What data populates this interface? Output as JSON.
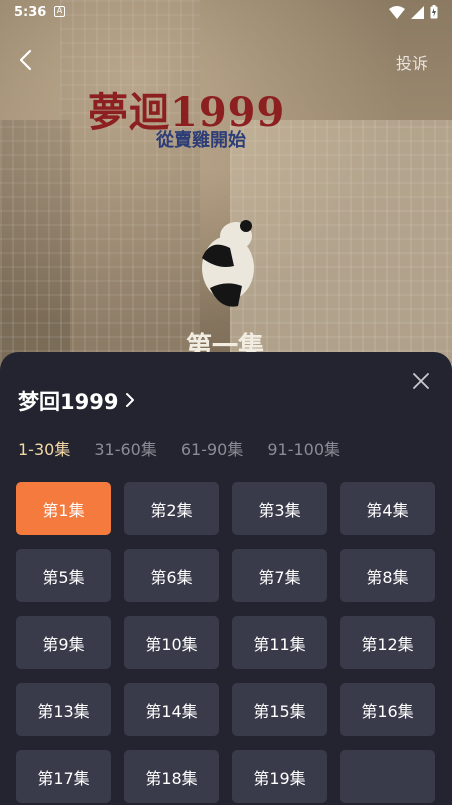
{
  "status_bar": {
    "time": "5:36"
  },
  "header": {
    "report_label": "投诉"
  },
  "poster": {
    "title": "夢迴1999",
    "subtitle": "從賣雞開始",
    "episode_caption": "第一集"
  },
  "sheet": {
    "show_title": "梦回1999",
    "tabs": [
      {
        "label": "1-30集",
        "active": true
      },
      {
        "label": "31-60集",
        "active": false
      },
      {
        "label": "61-90集",
        "active": false
      },
      {
        "label": "91-100集",
        "active": false
      }
    ],
    "episodes": [
      "第1集",
      "第2集",
      "第3集",
      "第4集",
      "第5集",
      "第6集",
      "第7集",
      "第8集",
      "第9集",
      "第10集",
      "第11集",
      "第12集",
      "第13集",
      "第14集",
      "第15集",
      "第16集",
      "第17集",
      "第18集",
      "第19集",
      ""
    ],
    "selected_episode": "第1集"
  },
  "colors": {
    "accent": "#f47a3e",
    "active_tab": "#f3d8a6",
    "sheet_bg": "#23242f",
    "button_bg": "#393b4b"
  }
}
